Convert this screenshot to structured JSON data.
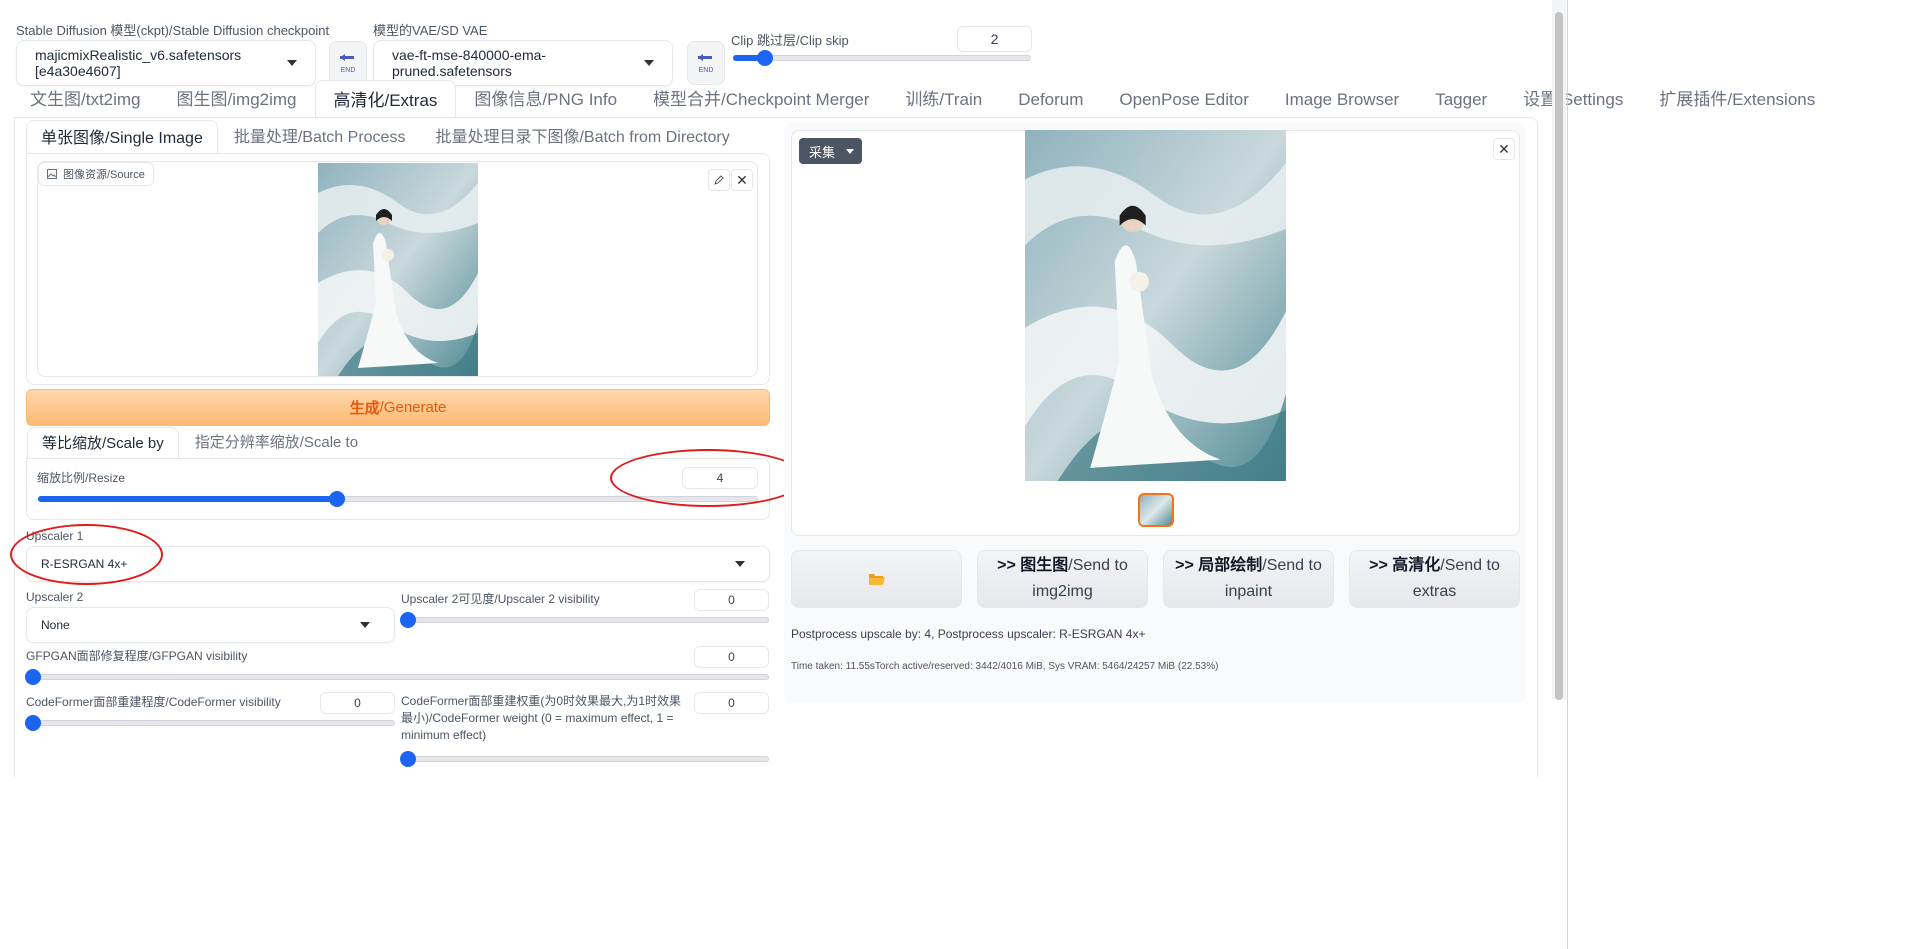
{
  "header": {
    "checkpoint_label": "Stable Diffusion 模型(ckpt)/Stable Diffusion checkpoint",
    "checkpoint_value": "majicmixRealistic_v6.safetensors [e4a30e4607]",
    "vae_label": "模型的VAE/SD VAE",
    "vae_value": "vae-ft-mse-840000-ema-pruned.safetensors",
    "clip_label": "Clip 跳过层/Clip skip",
    "clip_value": "2",
    "clip_level": 0.083,
    "end_icon_text": "END"
  },
  "main_tabs": [
    {
      "label": "文生图/txt2img"
    },
    {
      "label": "图生图/img2img"
    },
    {
      "label": "高清化/Extras"
    },
    {
      "label": "图像信息/PNG Info"
    },
    {
      "label": "模型合并/Checkpoint Merger"
    },
    {
      "label": "训练/Train"
    },
    {
      "label": "Deforum"
    },
    {
      "label": "OpenPose Editor"
    },
    {
      "label": "Image Browser"
    },
    {
      "label": "Tagger"
    },
    {
      "label": "设置/Settings"
    },
    {
      "label": "扩展插件/Extensions"
    }
  ],
  "sub_tabs": [
    {
      "label": "单张图像/Single Image"
    },
    {
      "label": "批量处理/Batch Process"
    },
    {
      "label": "批量处理目录下图像/Batch from Directory"
    }
  ],
  "source": {
    "label": "图像资源/Source"
  },
  "generate": {
    "label_cn": "生成",
    "label_en": "/Generate"
  },
  "scale_tabs": [
    {
      "label": "等比缩放/Scale by"
    },
    {
      "label": "指定分辨率缩放/Scale to"
    }
  ],
  "resize": {
    "label": "缩放比例/Resize",
    "value": "4",
    "level": 0.415
  },
  "upscaler1": {
    "label": "Upscaler 1",
    "value": "R-ESRGAN 4x+"
  },
  "upscaler2": {
    "label": "Upscaler 2",
    "value": "None"
  },
  "upscaler2_visibility": {
    "label": "Upscaler 2可见度/Upscaler 2 visibility",
    "value": "0"
  },
  "gfpgan": {
    "label": "GFPGAN面部修复程度/GFPGAN visibility",
    "value": "0"
  },
  "codeformer_visibility": {
    "label": "CodeFormer面部重建程度/CodeFormer visibility",
    "value": "0"
  },
  "codeformer_weight": {
    "label": "CodeFormer面部重建权重(为0时效果最大,为1时效果最小)/CodeFormer weight (0 = maximum effect, 1 = minimum effect)",
    "value": "0"
  },
  "output": {
    "collect_label": "采集",
    "send_img2img_bold": "图生图",
    "send_img2img_rest": "/Send to img2img",
    "send_inpaint_bold": "局部绘制",
    "send_inpaint_rest": "/Send to inpaint",
    "send_extras_bold": "高清化",
    "send_extras_rest": "/Send to extras",
    "arrow": ">>",
    "postprocess_text": "Postprocess upscale by: 4, Postprocess upscaler: R-ESRGAN 4x+",
    "time_text": "Time taken: 11.55sTorch active/reserved: 3442/4016 MiB, Sys VRAM: 5464/24257 MiB (22.53%)"
  },
  "colors": {
    "accent": "#1c64f2",
    "generate_text": "#ea580c",
    "annotation": "#e01b1b"
  }
}
